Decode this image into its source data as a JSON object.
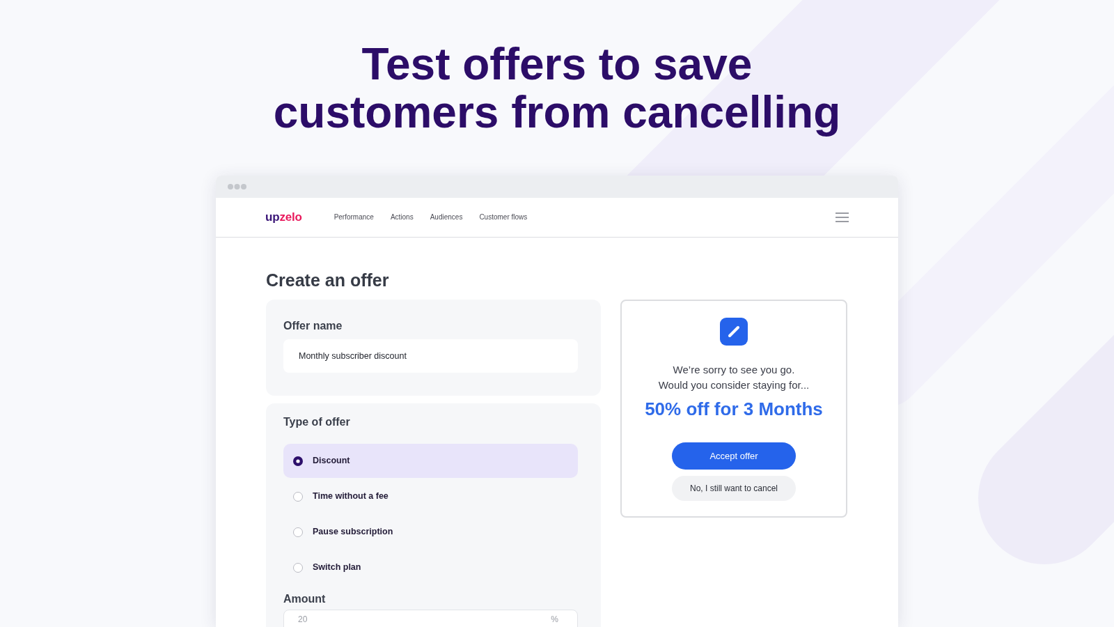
{
  "headline": "Test offers to save customers from cancelling",
  "app": {
    "logo": [
      {
        "text": "up",
        "color": "#3a1577"
      },
      {
        "text": "zelo",
        "color": "#e9195c"
      }
    ],
    "nav_links": [
      "Performance",
      "Actions",
      "Audiences",
      "Customer flows"
    ],
    "page_title": "Create an offer",
    "offer_name": {
      "label": "Offer name",
      "value": "Monthly subscriber discount"
    },
    "type_of_offer": {
      "label": "Type of offer",
      "options": [
        {
          "label": "Discount",
          "selected": true
        },
        {
          "label": "Time without a fee",
          "selected": false
        },
        {
          "label": "Pause subscription",
          "selected": false
        },
        {
          "label": "Switch plan",
          "selected": false
        }
      ]
    },
    "amount": {
      "label": "Amount",
      "value": "20",
      "unit": "%"
    },
    "preview": {
      "message": [
        "We’re sorry to see you go.",
        "Would you consider staying for..."
      ],
      "offer": "50% off for 3 Months",
      "buttons": [
        {
          "label": "Accept offer",
          "kind": "primary"
        },
        {
          "label": "No, I still want to cancel",
          "kind": "secondary"
        }
      ]
    }
  }
}
